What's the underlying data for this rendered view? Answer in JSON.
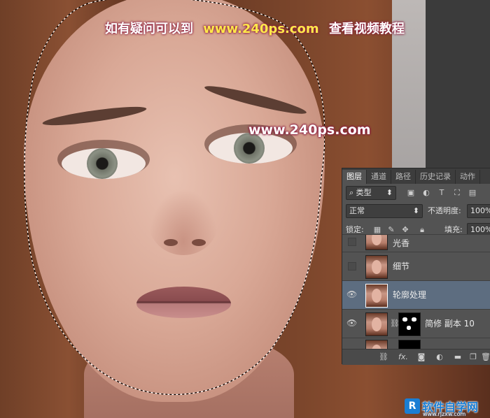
{
  "watermarks": {
    "top_left_text": "如有疑问可以到",
    "top_url": "www.240ps.com",
    "top_right_text": "查看视频教程",
    "center_url": "www.240ps.com"
  },
  "layers_panel": {
    "tabs": [
      "图层",
      "通道",
      "路径",
      "历史记录",
      "动作"
    ],
    "active_tab": "图层",
    "filter_kind": "类型",
    "blend_mode": "正常",
    "opacity_label": "不透明度:",
    "opacity_value": "100%",
    "lock_label": "锁定:",
    "fill_label": "填充:",
    "fill_value": "100%",
    "layers": [
      {
        "name": "光香",
        "visible": false,
        "selected": false,
        "has_mask": false
      },
      {
        "name": "细节",
        "visible": false,
        "selected": false,
        "has_mask": false
      },
      {
        "name": "轮廓处理",
        "visible": true,
        "selected": true,
        "has_mask": false
      },
      {
        "name": "简修 副本 10",
        "visible": true,
        "selected": false,
        "has_mask": true
      }
    ],
    "footer_fx_label": "fx."
  },
  "site_logo": {
    "mark": "R",
    "title": "软件自学网",
    "url": "www.rjzxw.com",
    "color": "#1a7ed4"
  },
  "icons": {
    "visibility": "eye-icon",
    "search": "search-icon",
    "link": "link-icon",
    "new_layer": "new-layer-icon",
    "trash": "trash-icon",
    "folder": "folder-icon",
    "mask": "mask-icon",
    "adjustment": "adjustment-icon"
  }
}
